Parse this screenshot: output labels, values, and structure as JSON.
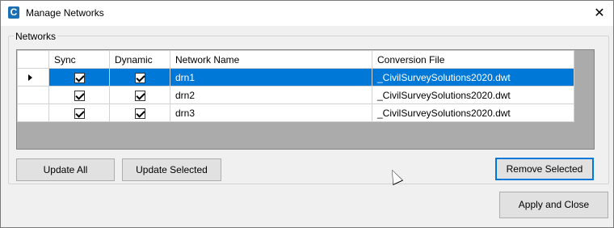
{
  "window": {
    "title": "Manage Networks",
    "app_icon": "civil-survey-c-icon",
    "close_glyph": "✕"
  },
  "groupbox": {
    "label": "Networks"
  },
  "grid": {
    "columns": [
      "Sync",
      "Dynamic",
      "Network Name",
      "Conversion File"
    ],
    "rows": [
      {
        "sync": true,
        "dynamic": true,
        "name": "drn1",
        "file": "_CivilSurveySolutions2020.dwt",
        "selected": true
      },
      {
        "sync": true,
        "dynamic": true,
        "name": "drn2",
        "file": "_CivilSurveySolutions2020.dwt",
        "selected": false
      },
      {
        "sync": true,
        "dynamic": true,
        "name": "drn3",
        "file": "_CivilSurveySolutions2020.dwt",
        "selected": false
      }
    ]
  },
  "buttons": {
    "update_all": "Update All",
    "update_selected": "Update Selected",
    "remove_selected": "Remove Selected",
    "apply_close": "Apply and Close"
  },
  "colors": {
    "selection": "#0078d7",
    "grid_background": "#ababab",
    "button_face": "#e1e1e1"
  }
}
